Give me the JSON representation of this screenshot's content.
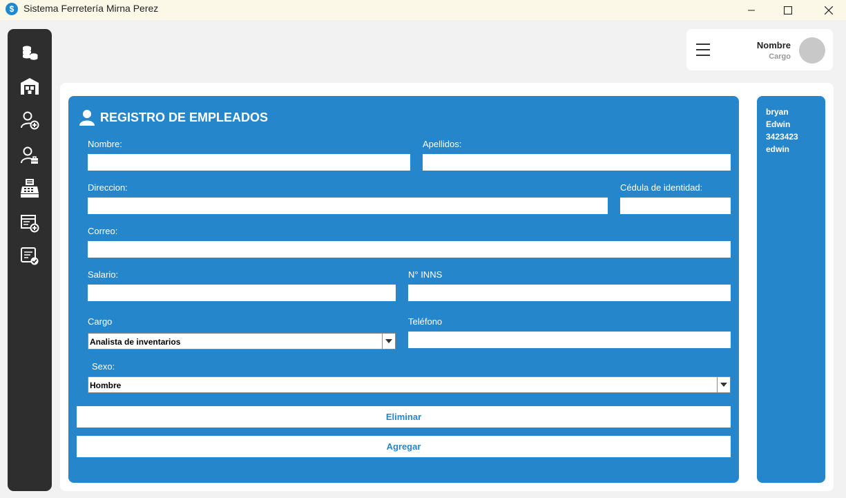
{
  "window": {
    "title": "Sistema Ferretería Mirna Perez",
    "app_icon_letter": "$"
  },
  "sidebar": {
    "items": [
      {
        "name": "coins-icon"
      },
      {
        "name": "warehouse-icon"
      },
      {
        "name": "user-add-icon"
      },
      {
        "name": "user-briefcase-icon"
      },
      {
        "name": "cash-register-icon"
      },
      {
        "name": "invoice-add-icon"
      },
      {
        "name": "report-check-icon"
      }
    ]
  },
  "user": {
    "name": "Nombre",
    "role": "Cargo"
  },
  "form": {
    "title": "REGISTRO DE EMPLEADOS",
    "fields": {
      "nombre_label": "Nombre:",
      "apellidos_label": "Apellidos:",
      "direccion_label": "Direccion:",
      "cedula_label": "Cédula de identidad:",
      "correo_label": "Correo:",
      "salario_label": "Salario:",
      "inns_label": "N° INNS",
      "cargo_label": "Cargo",
      "telefono_label": "Teléfono",
      "sexo_label": "Sexo:"
    },
    "values": {
      "nombre": "",
      "apellidos": "",
      "direccion": "",
      "cedula": "",
      "correo": "",
      "salario": "",
      "inns": "",
      "telefono": "",
      "cargo": "Analista de inventarios",
      "sexo": "Hombre"
    },
    "buttons": {
      "eliminar": "Eliminar",
      "agregar": "Agregar"
    }
  },
  "employee_list": [
    "bryan",
    "Edwin",
    "3423423",
    "edwin"
  ],
  "colors": {
    "primary": "#2586cb",
    "sidebar": "#2e2e2e",
    "background": "#f2f2f2"
  }
}
